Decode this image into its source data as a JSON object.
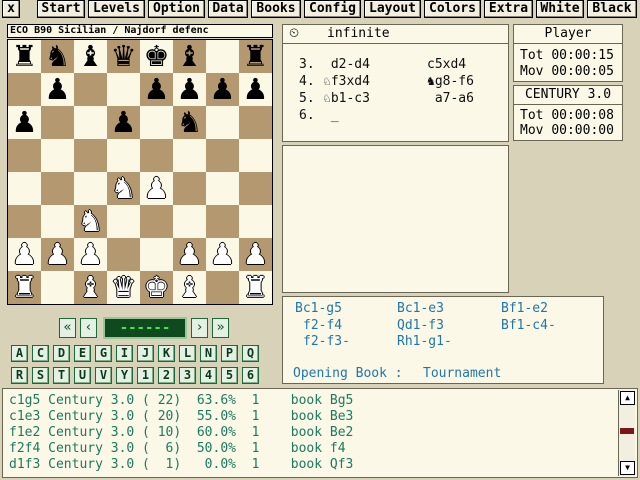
{
  "menu": {
    "close_label": "x",
    "items": [
      "Start",
      "Levels",
      "Option",
      "Data",
      "Books",
      "Config",
      "Layout",
      "Colors",
      "Extra",
      "White",
      "Black"
    ]
  },
  "board_title": "ECO B90 Sicilian / Najdorf defenc",
  "board_rows": [
    [
      "bR",
      "bN",
      "bB",
      "bQ",
      "bK",
      "bB",
      "",
      "bR"
    ],
    [
      "",
      "bP",
      "",
      "",
      "bP",
      "bP",
      "bP",
      "bP"
    ],
    [
      "bP",
      "",
      "",
      "bP",
      "",
      "bN",
      "",
      ""
    ],
    [
      "",
      "",
      "",
      "",
      "",
      "",
      "",
      ""
    ],
    [
      "",
      "",
      "",
      "wN",
      "wP",
      "",
      "",
      ""
    ],
    [
      "",
      "",
      "wN",
      "",
      "",
      "",
      "",
      ""
    ],
    [
      "wP",
      "wP",
      "wP",
      "",
      "",
      "wP",
      "wP",
      "wP"
    ],
    [
      "wR",
      "",
      "wB",
      "wQ",
      "wK",
      "wB",
      "",
      "wR"
    ]
  ],
  "piece_glyphs": {
    "K": "♚",
    "Q": "♛",
    "R": "♜",
    "B": "♝",
    "N": "♞",
    "P": "♟"
  },
  "notation": {
    "mode": "infinite",
    "moves": [
      {
        "num": "3.",
        "white": " d2-d4",
        "black": "c5xd4"
      },
      {
        "num": "4.",
        "white": "♘f3xd4",
        "black": "♞g8-f6"
      },
      {
        "num": "5.",
        "white": "♘b1-c3",
        "black": " a7-a6"
      },
      {
        "num": "6.",
        "white": " _",
        "black": ""
      }
    ]
  },
  "player_clock": {
    "title": "Player",
    "tot_label": "Tot",
    "tot": "00:00:15",
    "mov_label": "Mov",
    "mov": "00:00:05"
  },
  "engine_clock": {
    "title": "CENTURY 3.0",
    "tot_label": "Tot",
    "tot": "00:00:08",
    "mov_label": "Mov",
    "mov": "00:00:00"
  },
  "move_input": {
    "value": "------",
    "nav": [
      "«",
      "‹",
      "›",
      "»"
    ]
  },
  "file_buttons_row1": [
    "A",
    "C",
    "D",
    "E",
    "G",
    "I",
    "J",
    "K",
    "L",
    "N",
    "P",
    "Q"
  ],
  "file_buttons_row2": [
    "R",
    "S",
    "T",
    "U",
    "V",
    "Y",
    "1",
    "2",
    "3",
    "4",
    "5",
    "6"
  ],
  "book": {
    "moves": [
      "Bc1-g5",
      "Bc1-e3",
      "Bf1-e2",
      "f2-f4",
      "Qd1-f3",
      "Bf1-c4-",
      "f2-f3-",
      "Rh1-g1-"
    ],
    "label": "Opening Book :",
    "type": "Tournament"
  },
  "analysis_lines": [
    "c1g5 Century 3.0 ( 22)  63.6%  1    book Bg5",
    "c1e3 Century 3.0 ( 20)  55.0%  1    book Be3",
    "f1e2 Century 3.0 ( 10)  60.0%  1    book Be2",
    "f2f4 Century 3.0 (  6)  50.0%  1    book f4",
    "d1f3 Century 3.0 (  1)   0.0%  1    book Qf3"
  ],
  "scrollbar": {
    "up": "▲",
    "down": "▼"
  },
  "colors": {
    "board_dark": "#b49870",
    "board_light": "#fbf8e6",
    "book_text": "#1f77a8",
    "analysis_text": "#1b7a5e"
  }
}
